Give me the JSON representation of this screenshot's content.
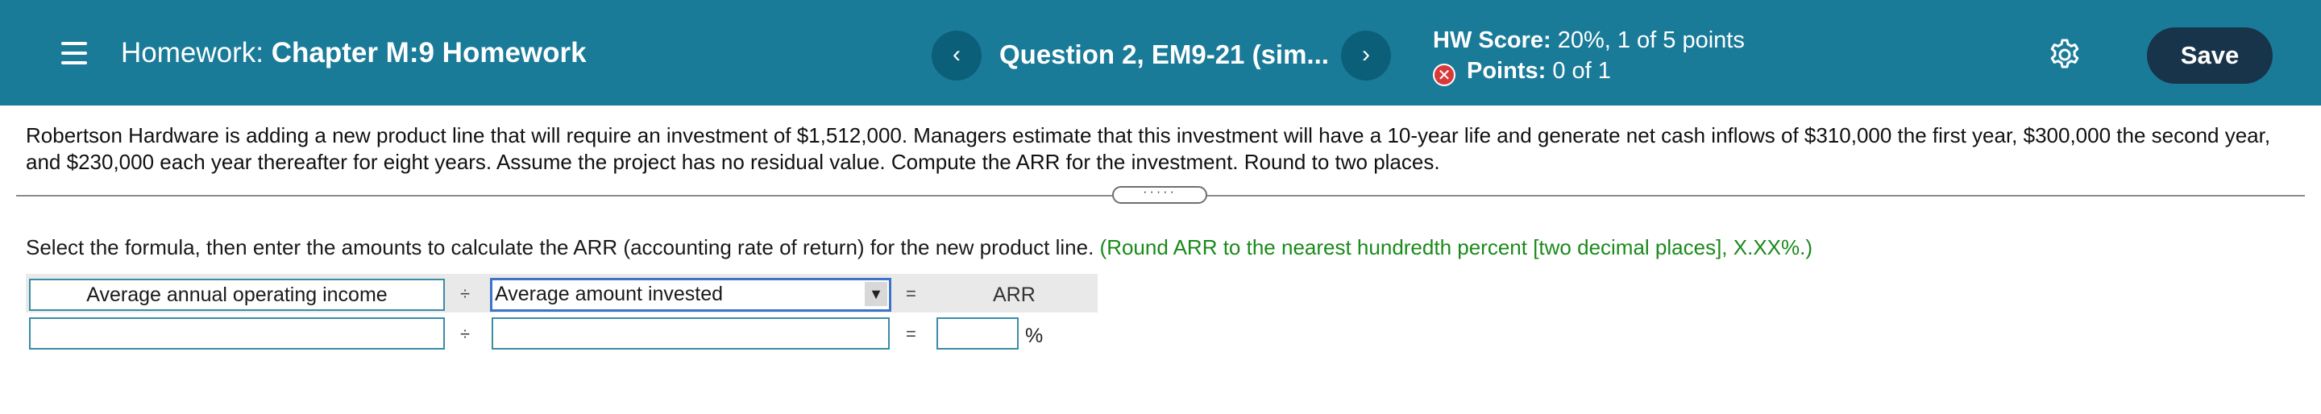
{
  "header": {
    "title_prefix": "Homework:",
    "title": "Chapter M:9 Homework",
    "prev_symbol": "‹",
    "next_symbol": "›",
    "question": "Question 2, EM9-21 (sim...",
    "hw_score_label": "HW Score:",
    "hw_score_value": "20%, 1 of 5 points",
    "points_label": "Points:",
    "points_value": "0 of 1",
    "points_status_symbol": "✕",
    "save_label": "Save",
    "colors": {
      "bar": "#1a7b99",
      "nav_button": "#0c5f78",
      "save_button": "#18344a",
      "incorrect": "#d83a3a"
    }
  },
  "problem": {
    "text": "Robertson Hardware is adding a new product line that will require an investment of $1,512,000. Managers estimate that this investment will have a 10-year life and generate net cash inflows of $310,000 the first year, $300,000 the second year, and $230,000 each year thereafter for eight years. Assume the project has no residual value. Compute the ARR for the investment. Round to two places.",
    "handle_dots": "·····"
  },
  "instruction": {
    "text": "Select the formula, then enter the amounts to calculate the ARR (accounting rate of return) for the new product line.",
    "hint": "(Round ARR to the nearest hundredth percent [two decimal places], X.XX%.)",
    "hint_color": "#1a8a1a"
  },
  "formula": {
    "numerator_label": "Average annual operating income",
    "divide_symbol": "÷",
    "denominator_selected": "Average amount invested",
    "dropdown_arrow": "▼",
    "equals_symbol": "=",
    "result_label": "ARR",
    "numerator_input": "",
    "denominator_input": "",
    "result_input": "",
    "percent_symbol": "%"
  }
}
